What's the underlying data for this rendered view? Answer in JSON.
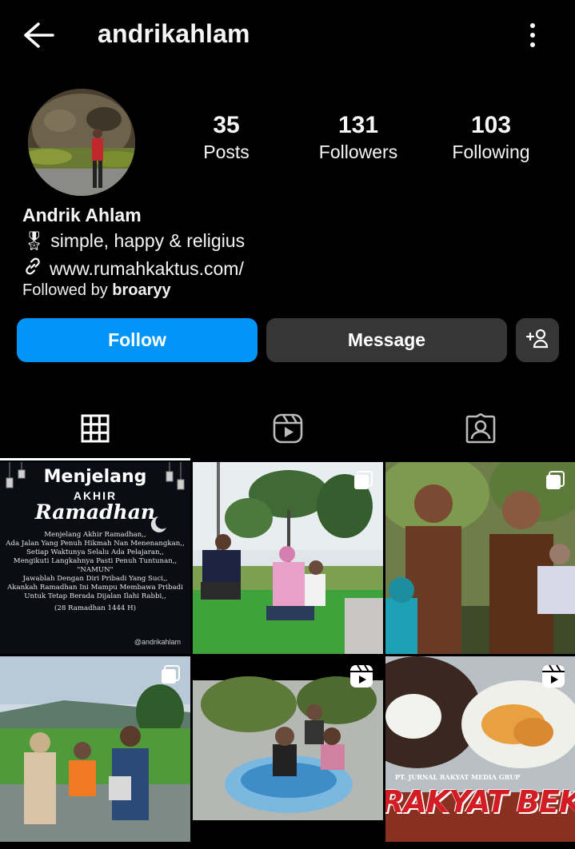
{
  "header": {
    "username": "andrikahlam"
  },
  "stats": [
    {
      "value": "35",
      "label": "Posts"
    },
    {
      "value": "131",
      "label": "Followers"
    },
    {
      "value": "103",
      "label": "Following"
    }
  ],
  "profile": {
    "display_name": "Andrik Ahlam",
    "bio_emoji": "🎖",
    "bio": "simple, happy & religius",
    "link": "www.rumahkaktus.com/",
    "followed_by_prefix": "Followed by ",
    "followed_by_user": "broaryy"
  },
  "actions": {
    "follow": "Follow",
    "message": "Message"
  },
  "posts": [
    {
      "title_line1": "Menjelang",
      "title_line2": "AKHIR",
      "title_line3": "Ramadhan",
      "lines": [
        "Menjelang Akhir Ramadhan,,",
        "Ada Jalan Yang Penuh Hikmah Nan Menenangkan,,",
        "Setiap Waktunya Selalu Ada Pelajaran,,",
        "Mengikuti Langkahnya Pasti Penuh Tuntunan,,",
        "\"NAMUN\"",
        "Jawablah Dengan Diri Pribadi Yang Suci,,",
        "Akankah Ramadhan Ini Mampu Membawa Pribadi",
        "Untuk Tetap Berada Dijalan Ilahi Rabbi,,",
        "(28 Ramadhan 1444 H)"
      ],
      "handle": "@andrikahlam"
    },
    {
      "overlay_text": ""
    },
    {
      "overlay_text": ""
    },
    {
      "overlay_text": ""
    },
    {
      "overlay_text": ""
    },
    {
      "banner_small": "PT. JURNAL RAKYAT MEDIA GRUP",
      "banner": "RAKYAT BEKASI"
    }
  ],
  "colors": {
    "accent": "#0095f6",
    "button_dark": "#363636",
    "background": "#000000"
  }
}
